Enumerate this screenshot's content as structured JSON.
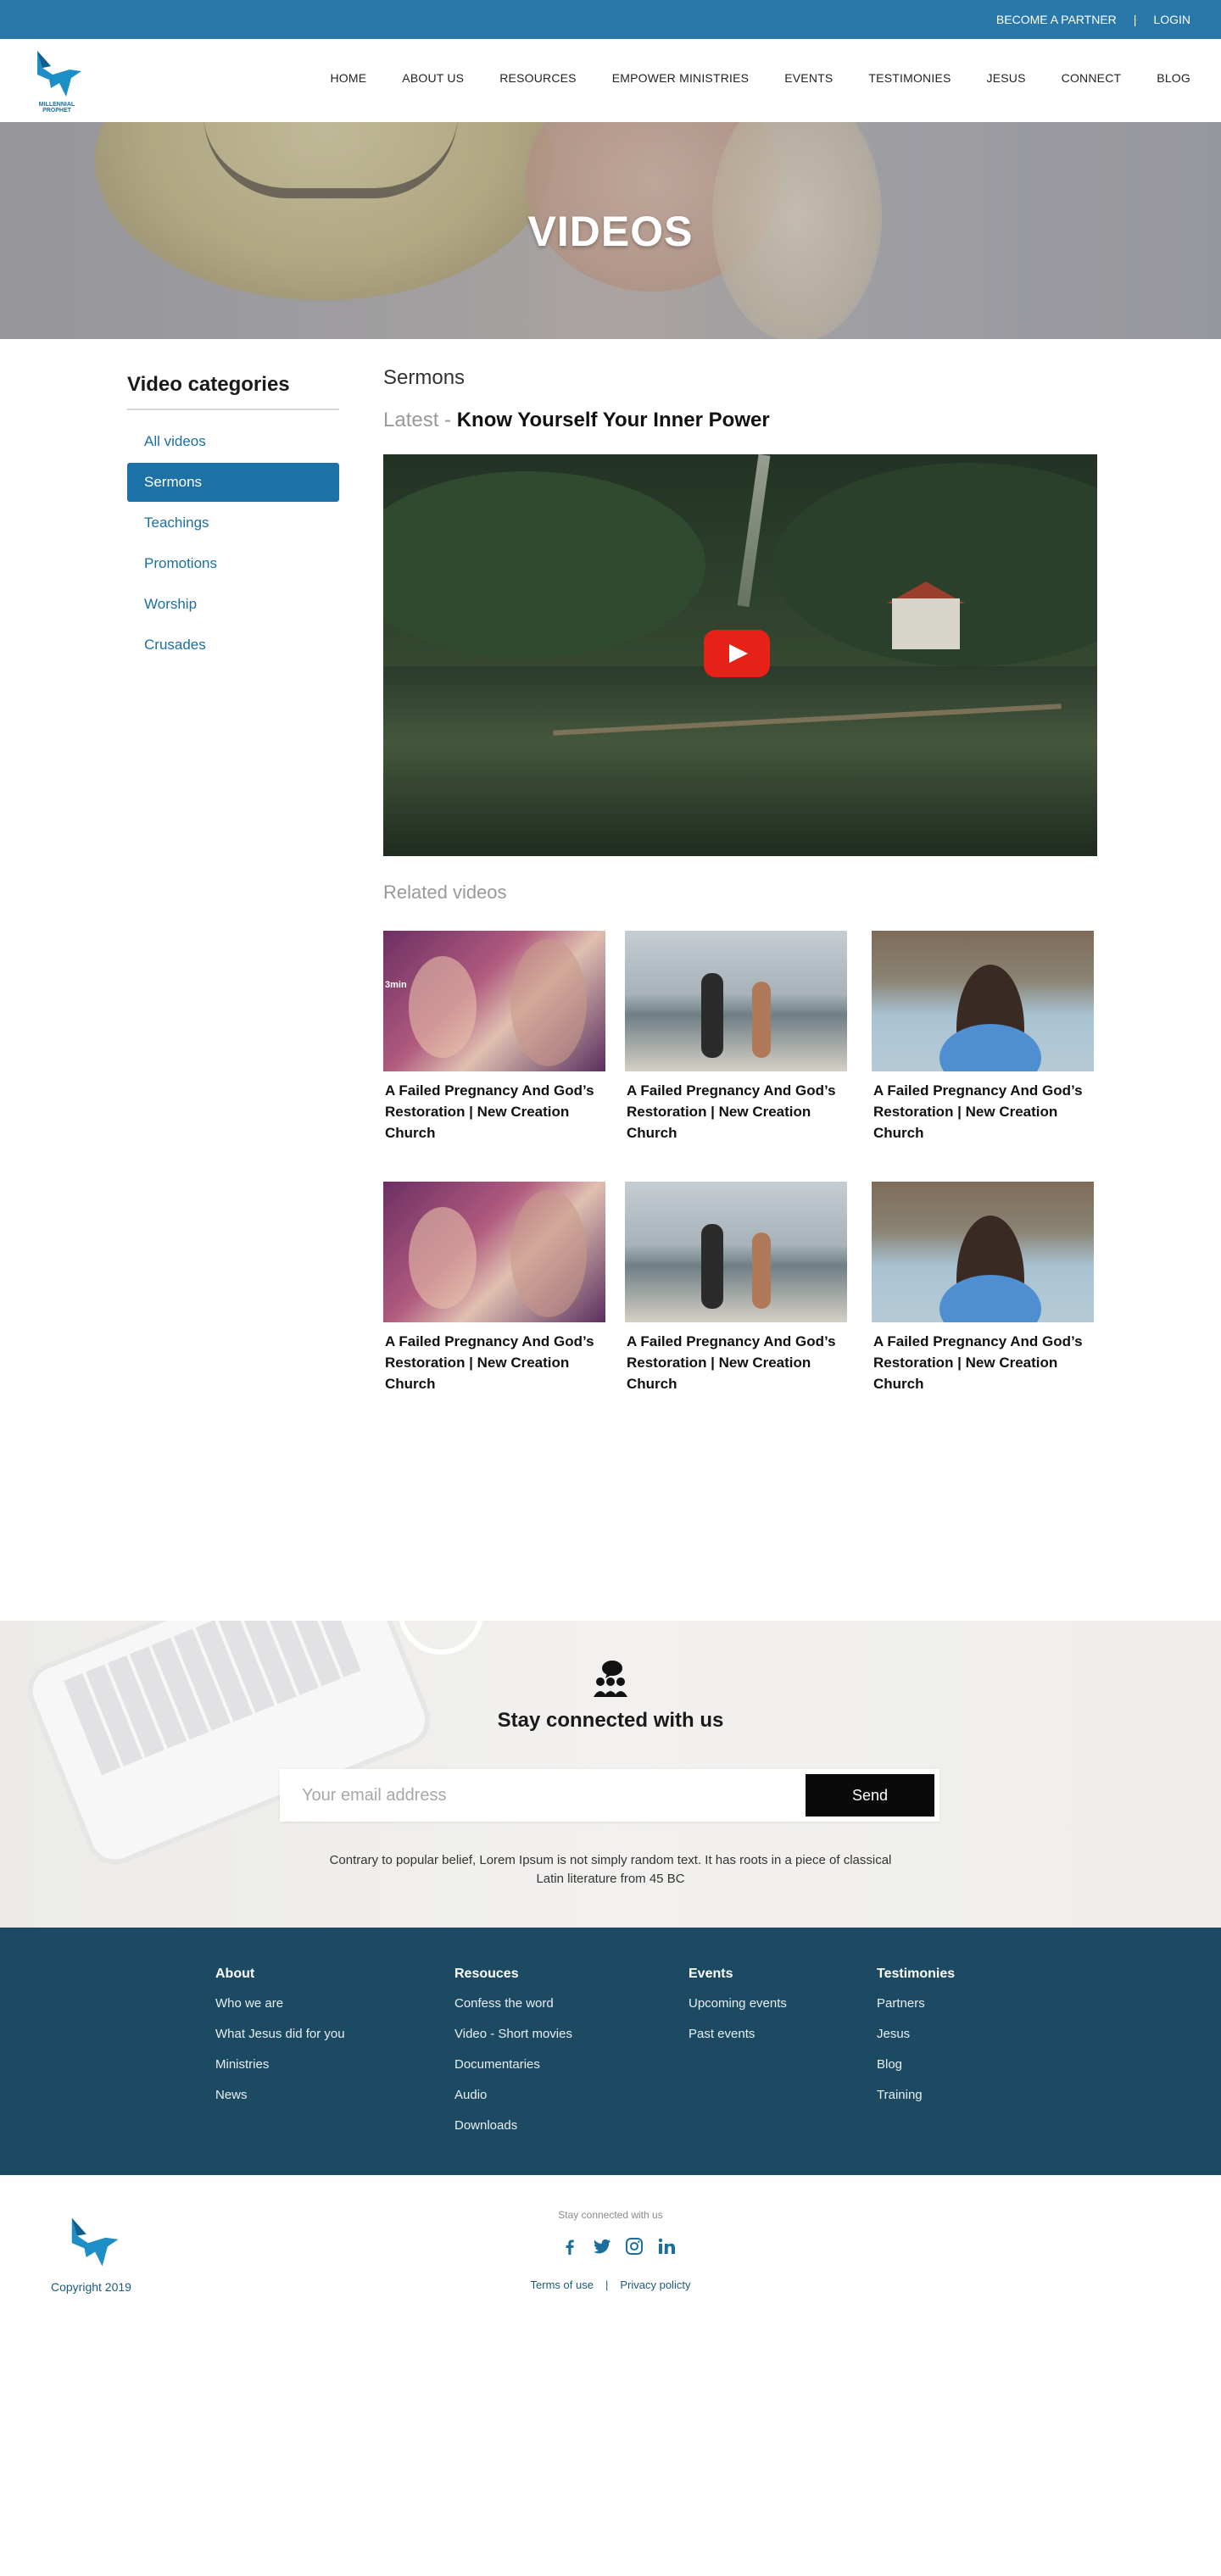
{
  "topbar": {
    "partner": "BECOME A PARTNER",
    "separator": "|",
    "login": "LOGIN"
  },
  "logo": {
    "text": "MILLENNIAL PROPHET"
  },
  "nav": {
    "items": [
      "HOME",
      "ABOUT US",
      "RESOURCES",
      "EMPOWER MINISTRIES",
      "EVENTS",
      "TESTIMONIES",
      "JESUS",
      "CONNECT",
      "BLOG"
    ]
  },
  "hero": {
    "title": "VIDEOS"
  },
  "sidebar": {
    "title": "Video categories",
    "items": [
      "All videos",
      "Sermons",
      "Teachings",
      "Promotions",
      "Worship",
      "Crusades"
    ],
    "active": "Sermons"
  },
  "main": {
    "section_title": "Sermons",
    "latest_prefix": "Latest - ",
    "latest_title": "Know Yourself Your Inner Power",
    "related_title": "Related videos",
    "videos": [
      {
        "title": "A Failed Pregnancy And God’s Restoration | New Creation Church",
        "duration": "3min"
      },
      {
        "title": "A Failed Pregnancy And God’s Restoration | New Creation Church"
      },
      {
        "title": "A Failed Pregnancy And God’s Restoration | New Creation Church"
      },
      {
        "title": "A Failed Pregnancy And God’s Restoration | New Creation Church"
      },
      {
        "title": "A Failed Pregnancy And God’s Restoration | New Creation Church"
      },
      {
        "title": "A Failed Pregnancy And God’s Restoration | New Creation Church"
      }
    ]
  },
  "stay": {
    "title": "Stay connected with us",
    "placeholder": "Your email address",
    "send": "Send",
    "description": "Contrary to popular belief, Lorem Ipsum is not simply random text. It has roots in a piece of classical Latin literature from 45 BC"
  },
  "footer": {
    "columns": [
      {
        "heading": "About",
        "links": [
          "Who we are",
          "What Jesus did for you",
          "Ministries",
          "News"
        ]
      },
      {
        "heading": "Resouces",
        "links": [
          "Confess the word",
          "Video - Short movies",
          "Documentaries",
          "Audio",
          "Downloads"
        ]
      },
      {
        "heading": "Events",
        "links": [
          "Upcoming events",
          "Past events"
        ]
      },
      {
        "heading": "Testimonies",
        "links": [
          "Partners",
          "Jesus",
          "Blog",
          "Training"
        ]
      }
    ]
  },
  "bottom": {
    "copyright": "Copyright 2019",
    "stay_small": "Stay connected with us",
    "terms": "Terms of use",
    "separator": "|",
    "privacy": "Privacy policty"
  },
  "colors": {
    "brand_blue": "#2a78aa",
    "active_blue": "#1c72a6",
    "footer_bg": "#1d4a63",
    "youtube_red": "#e62117"
  },
  "icons": [
    "dove-logo-icon",
    "play-icon",
    "chat-people-icon",
    "facebook-icon",
    "twitter-icon",
    "instagram-icon",
    "linkedin-icon"
  ]
}
